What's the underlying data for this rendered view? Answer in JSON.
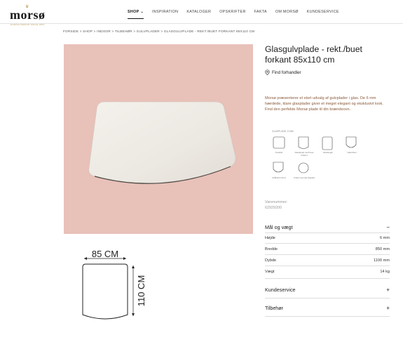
{
  "brand": {
    "name": "morsø",
    "tagline": "DANISH DESIGN SINCE 1853"
  },
  "nav": [
    {
      "label": "SHOP",
      "active": true
    },
    {
      "label": "INSPIRATION"
    },
    {
      "label": "KATALOGER"
    },
    {
      "label": "OPSKRIFTER"
    },
    {
      "label": "FAKTA"
    },
    {
      "label": "OM MORSØ"
    },
    {
      "label": "KUNDESERVICE"
    }
  ],
  "breadcrumb": "FORSIDE > SHOP > INDOOR > TILBEHØR > GULVPLADER > GLASGULVPLADE - REKT./BUET FORKANT 85X110 CM",
  "product": {
    "title": "Glasgulvplade - rekt./buet forkant 85x110 cm",
    "find_dealer": "Find forhandler",
    "description": "Morsø præsenterer et stort udvalg af gulvplader i glas. De 6 mm hærdede, klare glasplader giver et meget elegant og eksklusivt look. Find den perfekte Morsø plade til din brændeovn.",
    "variant_label": "Varenummer:",
    "variant_number": "62929200"
  },
  "shapes": {
    "title": "GLASPLADE, 6 MM",
    "items": [
      {
        "label": "Kvadrat",
        "dim": "100 CM"
      },
      {
        "label": "Rektangel med buet forkant",
        "dim": "85 CM"
      },
      {
        "label": "Rektangel",
        "dim": "85 CM"
      },
      {
        "label": "Halvcirkel",
        "dim": "100 CM"
      },
      {
        "label": "Dråbeform/rnd",
        "dim": "100 CM"
      },
      {
        "label": "Cirkel med tap (kaplet)",
        "dim": ""
      }
    ]
  },
  "drawing": {
    "width_label": "85 CM",
    "height_label": "110 CM"
  },
  "specs": {
    "heading": "Mål og vægt",
    "toggle": "−",
    "rows": [
      {
        "label": "Højde",
        "value": "6 mm"
      },
      {
        "label": "Bredde",
        "value": "850 mm"
      },
      {
        "label": "Dybde",
        "value": "1100 mm"
      },
      {
        "label": "Vægt",
        "value": "14 kg"
      }
    ]
  },
  "sections": [
    {
      "label": "Kundeservice",
      "toggle": "+"
    },
    {
      "label": "Tilbehør",
      "toggle": "+"
    }
  ],
  "colors": {
    "hero_bg": "#e8c1b9",
    "gold": "#b89a52",
    "desc": "#8a5a3a"
  }
}
